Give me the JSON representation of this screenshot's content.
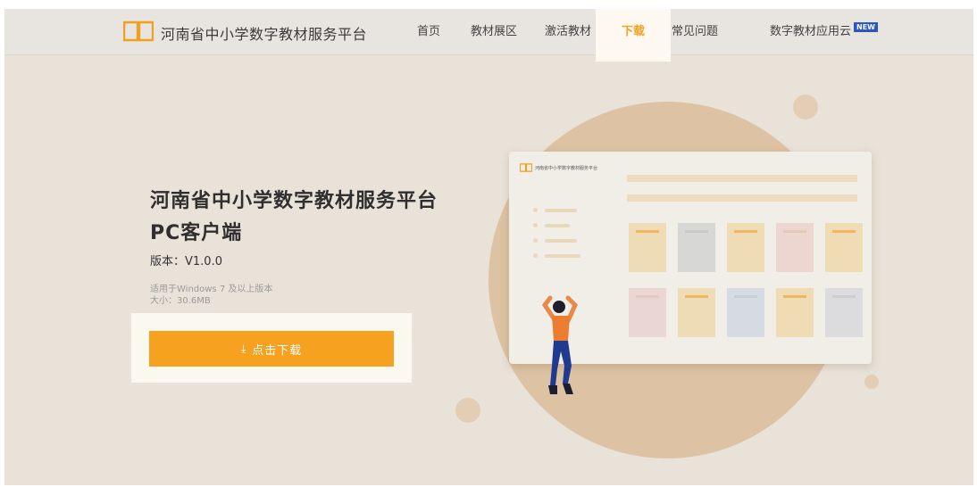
{
  "header": {
    "site_title": "河南省中小学数字教材服务平台",
    "nav": [
      "首页",
      "教材展区",
      "激活教材"
    ],
    "nav_active": "下载",
    "nav_faq": "常见问题",
    "nav_cloud": "数字教材应用云",
    "new_badge": "NEW"
  },
  "hero": {
    "title": "河南省中小学数字教材服务平台",
    "subtitle": "PC客户端",
    "version": "版本：V1.0.0",
    "requirement": "适用于Windows 7 及以上版本",
    "size": "大小：30.6MB",
    "download_label": "点击下载",
    "download_icon": "download-icon"
  },
  "illustration": {
    "mock_title": "河南省中小学数字教材服务平台"
  },
  "colors": {
    "accent": "#f6a120",
    "background": "#e9e2d8",
    "badge": "#2a56c6"
  }
}
